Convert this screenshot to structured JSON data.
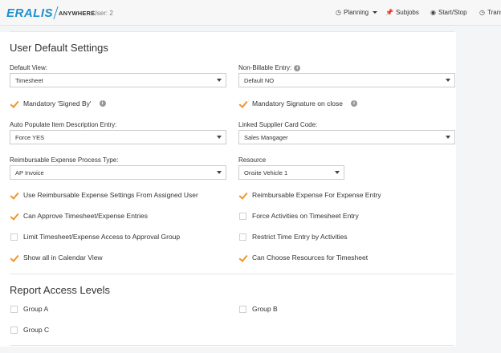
{
  "app": {
    "brand_main": "ERALIS",
    "brand_sub": "ANYWHERE",
    "user_label": "User: 2"
  },
  "nav": {
    "planning": "Planning",
    "subjobs": "Subjobs",
    "start_stop": "Start/Stop",
    "trans": "Trans"
  },
  "defaults": {
    "title": "User Default Settings",
    "default_view": {
      "label": "Default View:",
      "value": "Timesheet"
    },
    "non_billable": {
      "label": "Non-Billable Entry:",
      "value": "Default NO"
    },
    "mandatory_signed_by": {
      "label": "Mandatory 'Signed By'",
      "checked": true
    },
    "mandatory_signature": {
      "label": "Mandatory Signature on close",
      "checked": true
    },
    "auto_populate": {
      "label": "Auto Populate Item Description Entry:",
      "value": "Force YES"
    },
    "linked_supplier": {
      "label": "Linked Supplier Card Code:",
      "value": "Sales Mangager"
    },
    "reimb_type": {
      "label": "Reimbursable Expense Process Type:",
      "value": "AP Invoice"
    },
    "resource": {
      "label": "Resource",
      "value": "Onsite Vehicle 1"
    },
    "checkboxes_left": [
      {
        "label": "Use Reimbursable Expense Settings From Assigned User",
        "checked": true
      },
      {
        "label": "Can Approve Timesheet/Expense Entries",
        "checked": true
      },
      {
        "label": "Limit Timesheet/Expense Access to Approval Group",
        "checked": false
      },
      {
        "label": "Show all in Calendar View",
        "checked": true
      }
    ],
    "checkboxes_right": [
      {
        "label": "Reimbursable Expense For Expense Entry",
        "checked": true
      },
      {
        "label": "Force Activities on Timesheet Entry",
        "checked": false
      },
      {
        "label": "Restrict Time Entry by Activities",
        "checked": false
      },
      {
        "label": "Can Choose Resources for Timesheet",
        "checked": true
      }
    ]
  },
  "report_access": {
    "title": "Report Access Levels",
    "groups": [
      {
        "label": "Group A",
        "checked": false
      },
      {
        "label": "Group B",
        "checked": false
      },
      {
        "label": "Group C",
        "checked": false
      }
    ]
  },
  "colors": {
    "accent_check": "#f0952b",
    "brand_blue": "#1e8fd0"
  },
  "icons": {
    "info": "info-circle-icon",
    "planning": "clock-icon",
    "subjobs": "pin-icon",
    "start_stop": "stop-circle-icon"
  }
}
